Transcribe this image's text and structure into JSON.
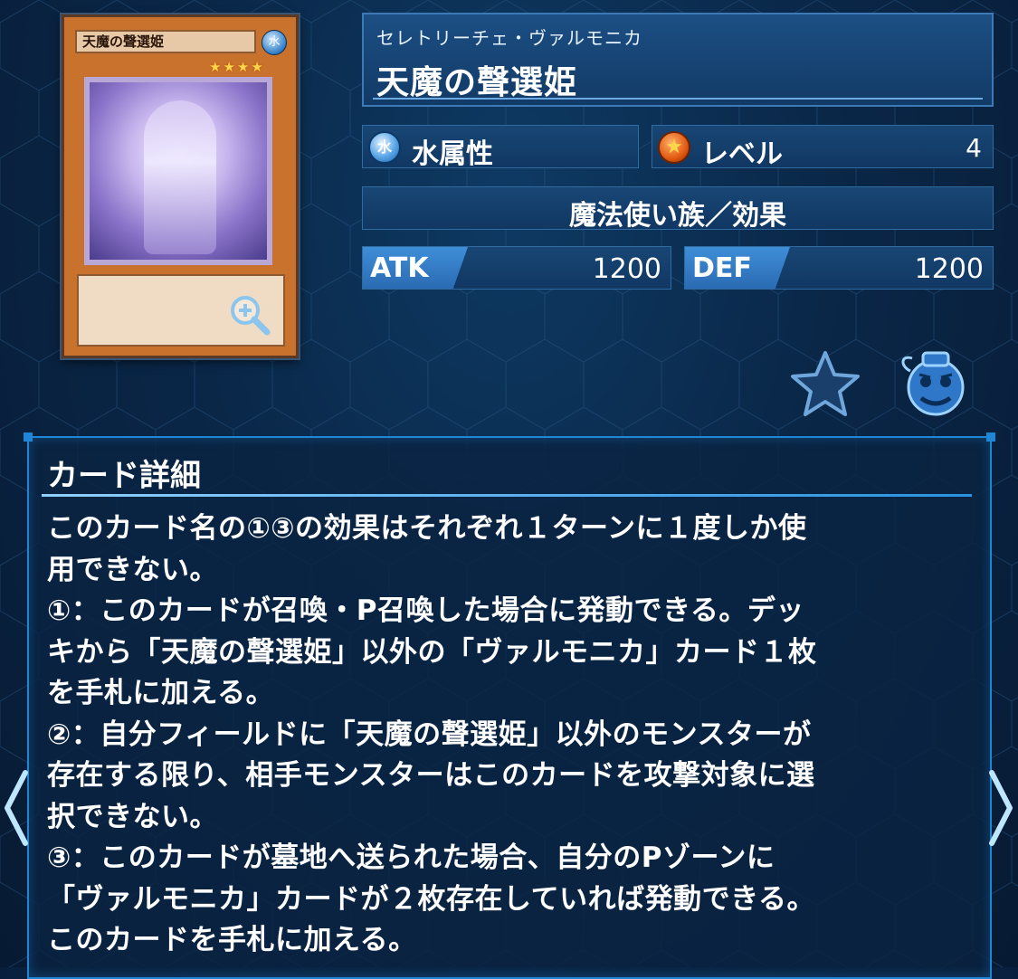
{
  "card": {
    "ruby": "セレトリーチェ・ヴァルモニカ",
    "name": "天魔の聲選姫",
    "thumb_name": "天魔の聲選姫",
    "thumb_attr_glyph": "水",
    "thumb_stars": "★★★★",
    "attribute_glyph": "水",
    "attribute": "水属性",
    "level_label": "レベル",
    "level": "4",
    "type": "魔法使い族／効果",
    "atk_label": "ATK",
    "atk": "1200",
    "def_label": "DEF",
    "def": "1200"
  },
  "detail": {
    "title": "カード詳細",
    "text": "このカード名の①③の効果はそれぞれ１ターンに１度しか使\n用できない。\n①：このカードが召喚・P召喚した場合に発動できる。デッ\nキから「天魔の聲選姫」以外の「ヴァルモニカ」カード１枚\nを手札に加える。\n②：自分フィールドに「天魔の聲選姫」以外のモンスターが\n存在する限り、相手モンスターはこのカードを攻撃対象に選\n択できない。\n③：このカードが墓地へ送られた場合、自分のPゾーンに\n「ヴァルモニカ」カードが２枚存在していれば発動できる。\nこのカードを手札に加える。"
  },
  "icons": {
    "zoom": "zoom-in-icon",
    "favorite": "star-icon",
    "deck": "pot-icon",
    "prev": "chevron-left-icon",
    "next": "chevron-right-icon"
  },
  "colors": {
    "accent": "#1f86d6",
    "background": "#0a2748",
    "card_frame": "#c9722d"
  }
}
